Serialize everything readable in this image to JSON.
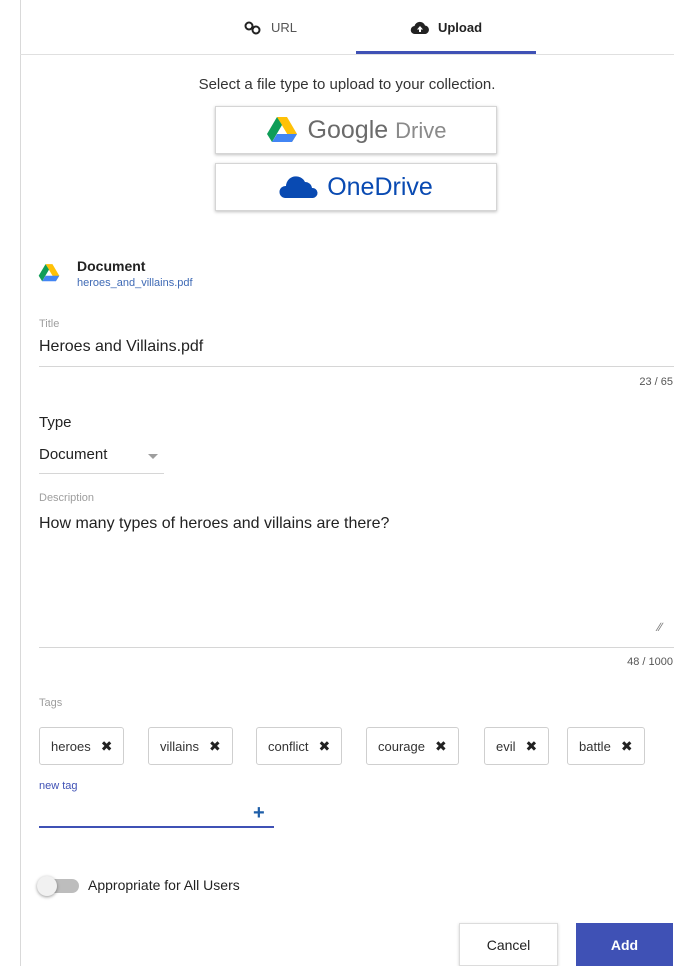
{
  "tabs": [
    {
      "label": "URL",
      "icon": "link-icon"
    },
    {
      "label": "Upload",
      "icon": "cloud-upload-icon",
      "active": true
    }
  ],
  "instruction": "Select a file type to upload to your collection.",
  "providers": {
    "google_drive": {
      "brand": "Google",
      "suffix": "Drive",
      "icon": "google-drive-icon"
    },
    "onedrive": {
      "label": "OneDrive",
      "icon": "onedrive-cloud-icon"
    }
  },
  "selected_file": {
    "type_label": "Document",
    "file_name": "heroes_and_villains.pdf",
    "icon": "google-drive-icon"
  },
  "form": {
    "title": {
      "label": "Title",
      "value": "Heroes and Villains.pdf",
      "counter": "23 / 65"
    },
    "type": {
      "label": "Type",
      "value": "Document"
    },
    "description": {
      "label": "Description",
      "value": "How many types of heroes and villains are there?",
      "counter": "48 / 1000"
    },
    "tags": {
      "label": "Tags",
      "items": [
        "heroes",
        "villains",
        "conflict",
        "courage",
        "evil",
        "battle"
      ],
      "new_tag_label": "new tag",
      "new_tag_value": ""
    },
    "appropriate": {
      "label": "Appropriate for All Users",
      "on": false
    }
  },
  "buttons": {
    "cancel": "Cancel",
    "add": "Add"
  },
  "colors": {
    "accent": "#3f51b5",
    "onedrive": "#094ab2",
    "link": "#3f6ab5"
  }
}
